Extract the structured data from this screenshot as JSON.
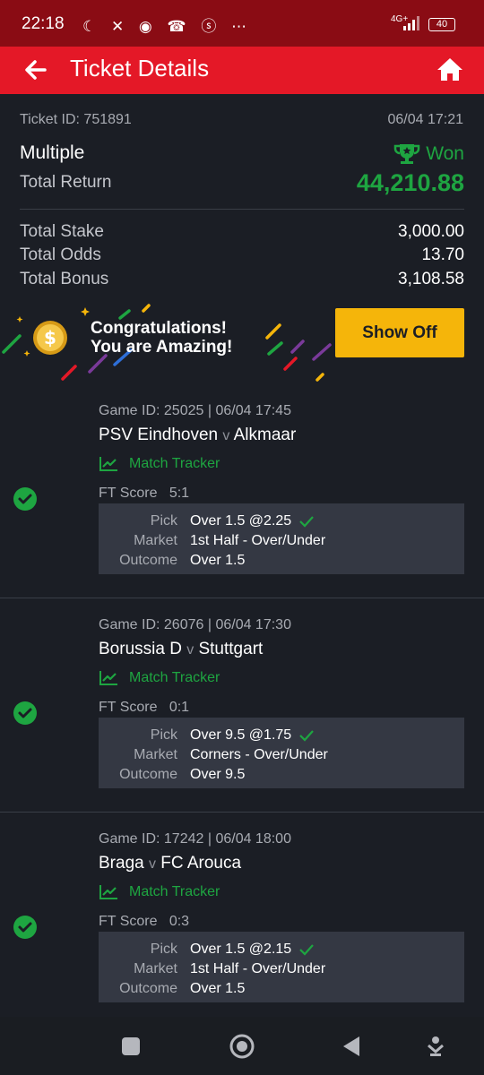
{
  "status_bar": {
    "time": "22:18",
    "icons": "☾ ✕ ◉ ☎ ⓢ ⋯",
    "network": "4G+",
    "battery": "40"
  },
  "header": {
    "title": "Ticket Details",
    "back_icon": "back-arrow-icon",
    "home_icon": "home-icon"
  },
  "ticket": {
    "id": "Ticket ID: 751891",
    "date": "06/04 17:21",
    "type": "Multiple",
    "status": "Won",
    "total_return_label": "Total Return",
    "total_return": "44,210.88",
    "rows": [
      {
        "label": "Total Stake",
        "value": "3,000.00"
      },
      {
        "label": "Total Odds",
        "value": "13.70"
      },
      {
        "label": "Total Bonus",
        "value": "3,108.58"
      }
    ]
  },
  "congrats": {
    "line1": "Congratulations!",
    "line2": "You are Amazing!",
    "button": "Show Off"
  },
  "selections": [
    {
      "game": "Game ID: 25025 | 06/04 17:45",
      "home": "PSV Eindhoven",
      "vs": "v",
      "away": "Alkmaar",
      "tracker": "Match Tracker",
      "ft": "FT Score   5:1",
      "pick_label": "Pick",
      "pick": "Over 1.5 @2.25",
      "market_label": "Market",
      "market": "1st Half - Over/Under",
      "outcome_label": "Outcome",
      "outcome": "Over 1.5"
    },
    {
      "game": "Game ID: 26076 | 06/04 17:30",
      "home": "Borussia D",
      "vs": "v",
      "away": "Stuttgart",
      "tracker": "Match Tracker",
      "ft": "FT Score   0:1",
      "pick_label": "Pick",
      "pick": "Over 9.5 @1.75",
      "market_label": "Market",
      "market": "Corners - Over/Under",
      "outcome_label": "Outcome",
      "outcome": "Over 9.5"
    },
    {
      "game": "Game ID: 17242 | 06/04 18:00",
      "home": "Braga",
      "vs": "v",
      "away": "FC Arouca",
      "tracker": "Match Tracker",
      "ft": "FT Score   0:3",
      "pick_label": "Pick",
      "pick": "Over 1.5 @2.15",
      "market_label": "Market",
      "market": "1st Half - Over/Under",
      "outcome_label": "Outcome",
      "outcome": "Over 1.5"
    }
  ],
  "colors": {
    "brand": "#e41827",
    "won": "#1ea541",
    "accent": "#f5b50a"
  }
}
